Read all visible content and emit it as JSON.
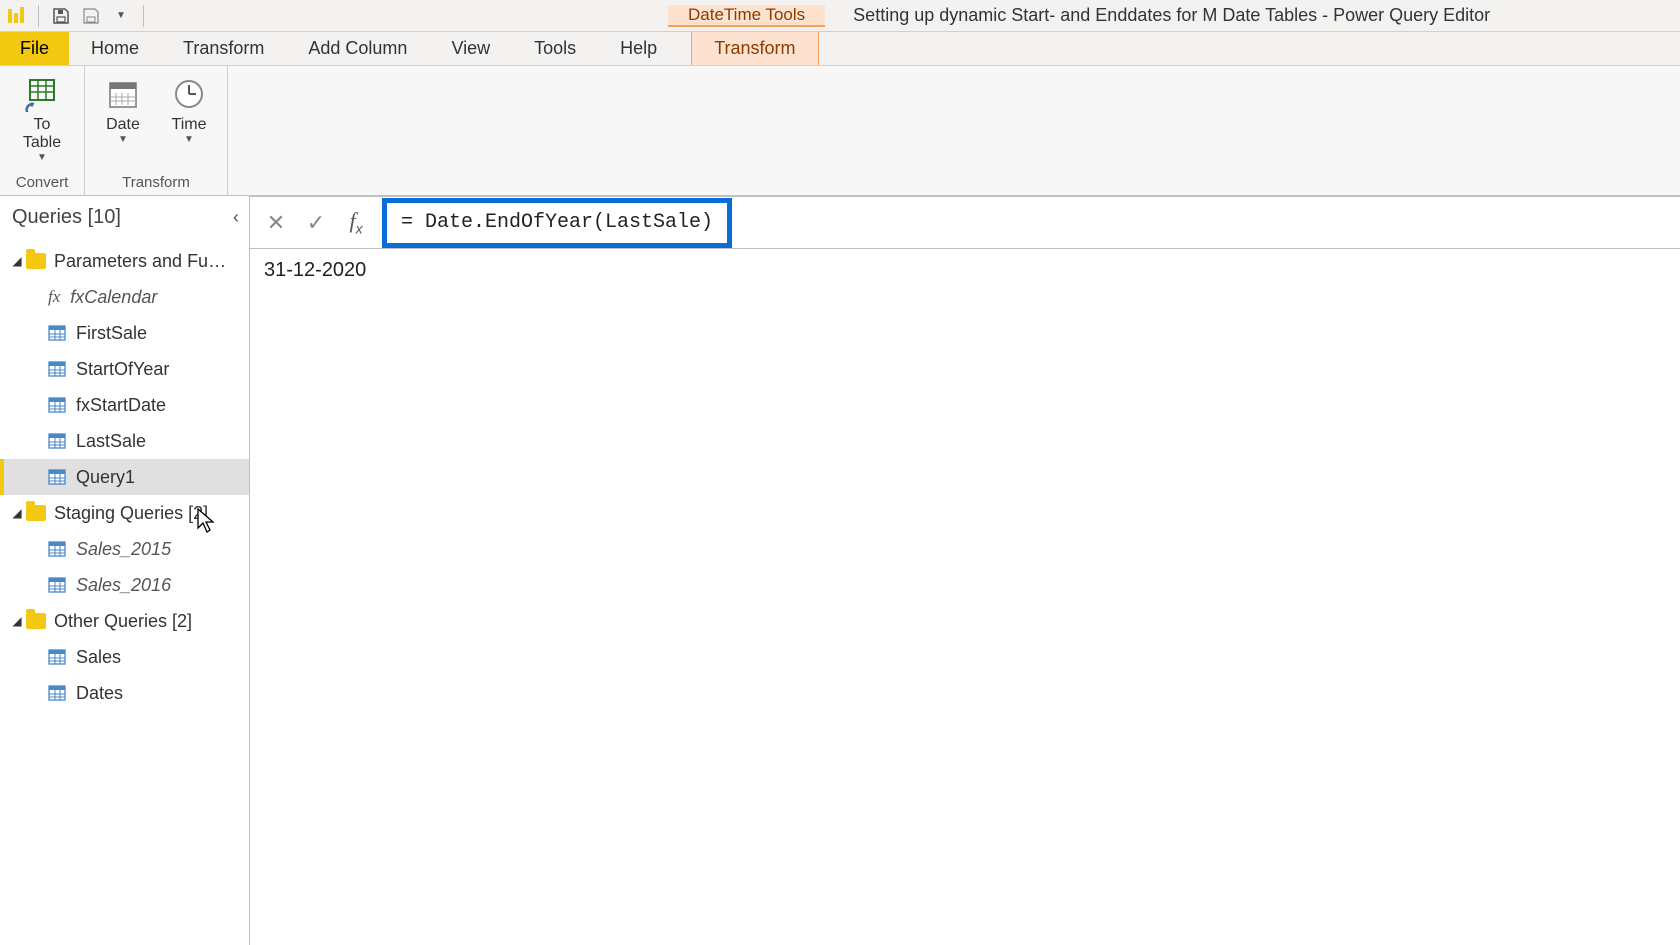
{
  "titlebar": {
    "context_tool_label": "DateTime Tools",
    "window_title": "Setting up dynamic Start- and Enddates for M Date Tables - Power Query Editor"
  },
  "tabs": {
    "file": "File",
    "home": "Home",
    "transform": "Transform",
    "add_column": "Add Column",
    "view": "View",
    "tools": "Tools",
    "help": "Help",
    "context_transform": "Transform"
  },
  "ribbon": {
    "convert": {
      "to_table": "To\nTable",
      "group_label": "Convert"
    },
    "transform": {
      "date": "Date",
      "time": "Time",
      "group_label": "Transform"
    }
  },
  "queries": {
    "header": "Queries [10]",
    "groups": [
      {
        "name": "Parameters and Fu…",
        "items": [
          {
            "label": "fxCalendar",
            "type": "fx",
            "italic": true
          },
          {
            "label": "FirstSale",
            "type": "table"
          },
          {
            "label": "StartOfYear",
            "type": "table"
          },
          {
            "label": "fxStartDate",
            "type": "table"
          },
          {
            "label": "LastSale",
            "type": "table"
          },
          {
            "label": "Query1",
            "type": "table",
            "selected": true
          }
        ]
      },
      {
        "name": "Staging Queries [2]",
        "items": [
          {
            "label": "Sales_2015",
            "type": "table",
            "italic": true
          },
          {
            "label": "Sales_2016",
            "type": "table",
            "italic": true
          }
        ]
      },
      {
        "name": "Other Queries [2]",
        "items": [
          {
            "label": "Sales",
            "type": "table"
          },
          {
            "label": "Dates",
            "type": "table"
          }
        ]
      }
    ]
  },
  "formula_bar": {
    "expression": "= Date.EndOfYear(LastSale)"
  },
  "preview": {
    "value": "31-12-2020"
  }
}
